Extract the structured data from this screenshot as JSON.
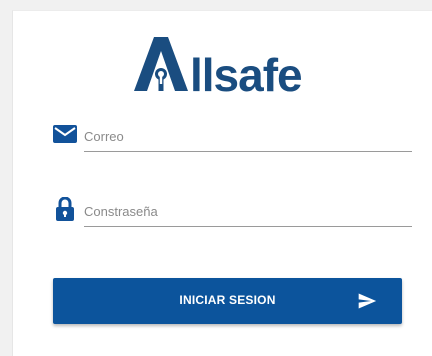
{
  "brand": {
    "name": "Allsafe",
    "color": "#1a4d80"
  },
  "form": {
    "email": {
      "icon": "email-icon",
      "placeholder": "Correo",
      "value": ""
    },
    "password": {
      "icon": "lock-icon",
      "placeholder": "Constraseña",
      "value": ""
    },
    "submit": {
      "label": "INICIAR SESION",
      "icon": "send-icon",
      "color": "#0c549c"
    }
  }
}
